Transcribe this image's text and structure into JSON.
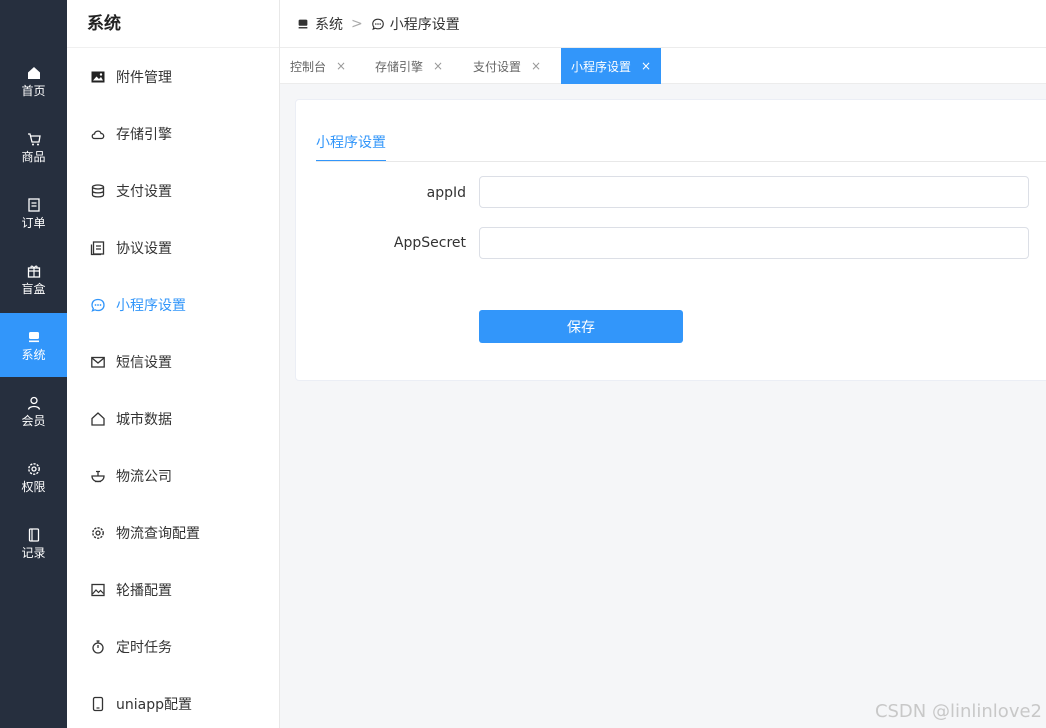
{
  "nav": {
    "items": [
      {
        "label": "首页",
        "icon": "home-icon"
      },
      {
        "label": "商品",
        "icon": "cart-icon"
      },
      {
        "label": "订单",
        "icon": "order-icon"
      },
      {
        "label": "盲盒",
        "icon": "gift-icon"
      },
      {
        "label": "系统",
        "icon": "monitor-icon"
      },
      {
        "label": "会员",
        "icon": "user-icon"
      },
      {
        "label": "权限",
        "icon": "gear-icon"
      },
      {
        "label": "记录",
        "icon": "book-icon"
      }
    ],
    "active_index": 4
  },
  "sidebar": {
    "title": "系统",
    "items": [
      {
        "label": "附件管理",
        "icon": "image-icon"
      },
      {
        "label": "存储引擎",
        "icon": "cloud-icon"
      },
      {
        "label": "支付设置",
        "icon": "database-icon"
      },
      {
        "label": "协议设置",
        "icon": "document-icon"
      },
      {
        "label": "小程序设置",
        "icon": "chat-icon"
      },
      {
        "label": "短信设置",
        "icon": "mail-icon"
      },
      {
        "label": "城市数据",
        "icon": "house-icon"
      },
      {
        "label": "物流公司",
        "icon": "bowl-icon"
      },
      {
        "label": "物流查询配置",
        "icon": "gear-icon"
      },
      {
        "label": "轮播配置",
        "icon": "picture-icon"
      },
      {
        "label": "定时任务",
        "icon": "timer-icon"
      },
      {
        "label": "uniapp配置",
        "icon": "phone-icon"
      }
    ],
    "active_index": 4
  },
  "breadcrumb": {
    "root": "系统",
    "separator": ">",
    "current": "小程序设置"
  },
  "tabs": [
    {
      "label": "控制台",
      "close": "×"
    },
    {
      "label": "存储引擎",
      "close": "×"
    },
    {
      "label": "支付设置",
      "close": "×"
    },
    {
      "label": "小程序设置",
      "close": "×"
    }
  ],
  "active_tab": 3,
  "card": {
    "tab_label": "小程序设置",
    "fields": [
      {
        "label": "appId",
        "value": ""
      },
      {
        "label": "AppSecret",
        "value": ""
      }
    ],
    "save_label": "保存"
  },
  "watermark": "CSDN @linlinlove2",
  "colors": {
    "accent": "#3296fa",
    "nav_bg": "#262f3e"
  }
}
